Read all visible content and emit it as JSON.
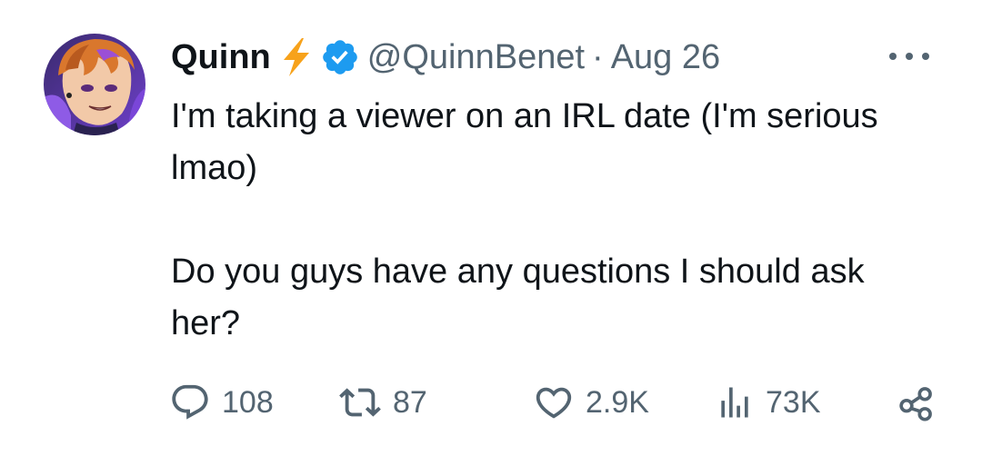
{
  "tweet": {
    "author": {
      "name": "Quinn",
      "handle": "@QuinnBenet",
      "separator": "·",
      "date": "Aug 26",
      "name_emoji_icon": "lightning-bolt-icon",
      "verified_icon": "verified-badge-icon",
      "avatar_description_icon": "avatar-image"
    },
    "text": {
      "paragraph_1": "I'm taking a viewer on an IRL date (I'm serious lmao)",
      "paragraph_2": "Do you guys have any questions I should ask her?"
    },
    "actions": {
      "replies": "108",
      "reposts": "87",
      "likes": "2.9K",
      "views": "73K"
    },
    "colors": {
      "text_primary": "#0f1419",
      "text_secondary": "#536471",
      "verified_blue": "#1d9bf0",
      "bolt_orange": "#f7a21b"
    }
  }
}
